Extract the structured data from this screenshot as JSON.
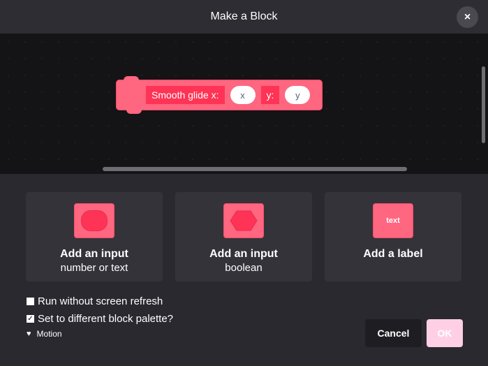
{
  "header": {
    "title": "Make a Block",
    "close_icon": "×"
  },
  "block": {
    "label_1": "Smooth glide x:",
    "input_1": "x",
    "label_2": "y:",
    "input_2": "y",
    "color": "#ff6680"
  },
  "options": [
    {
      "title": "Add an input",
      "subtitle": "number or text",
      "icon": "oval-input-icon"
    },
    {
      "title": "Add an input",
      "subtitle": "boolean",
      "icon": "hexagon-boolean-icon"
    },
    {
      "title": "Add a label",
      "subtitle": "",
      "icon": "text-label-icon",
      "icon_text": "text"
    }
  ],
  "settings": {
    "run_without_refresh": {
      "label": "Run without screen refresh",
      "checked": false
    },
    "different_palette": {
      "label": "Set to different block palette?",
      "checked": true,
      "check_glyph": "✓"
    },
    "palette": {
      "name": "Motion",
      "icon": "heart-icon",
      "glyph": "♥"
    }
  },
  "buttons": {
    "cancel": "Cancel",
    "ok": "OK"
  },
  "colors": {
    "accent": "#ff6680",
    "ok_disabled": "#ffcfe6",
    "background": "#2a2930"
  }
}
